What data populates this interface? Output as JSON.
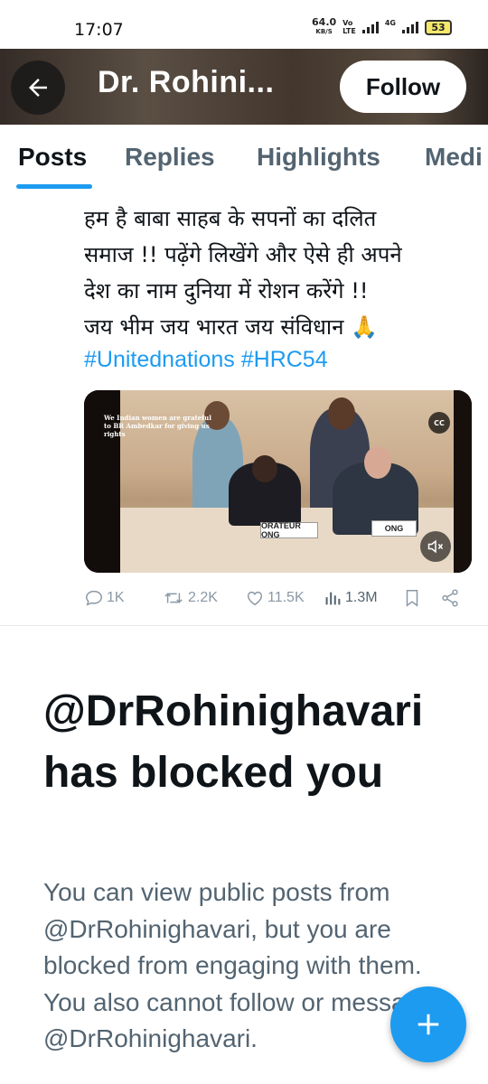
{
  "status_bar": {
    "time": "17:07",
    "net_speed_value": "64.0",
    "net_speed_unit": "KB/S",
    "volte_top": "Vo",
    "volte_bottom": "LTE",
    "network": "4G",
    "battery": "53"
  },
  "header": {
    "title": "Dr. Rohini...",
    "follow_label": "Follow",
    "back_icon": "arrow-left-icon"
  },
  "tabs": [
    {
      "label": "Posts",
      "active": true
    },
    {
      "label": "Replies",
      "active": false
    },
    {
      "label": "Highlights",
      "active": false
    },
    {
      "label": "Medi",
      "active": false
    }
  ],
  "post": {
    "text_lines": [
      "हम है बाबा साहब के सपनों का दलित",
      "समाज !! पढ़ेंगे लिखेंगे और ऐसे ही अपने",
      "देश का नाम दुनिया में रोशन करेंगे !!",
      "जय भीम जय भारत जय संविधान 🙏"
    ],
    "hashtags": "#Unitednations #HRC54",
    "media": {
      "caption": "We Indian women are grateful to BR Ambedkar for giving us rights",
      "sign_left": "ORATEUR ONG",
      "sign_right": "ONG",
      "cc_label": "CC"
    },
    "stats": {
      "replies": "1K",
      "reposts": "2.2K",
      "likes": "11.5K",
      "views": "1.3M"
    }
  },
  "blocked": {
    "title": "@DrRohinighavari has blocked you",
    "description": "You can view public posts from @DrRohinighavari, but you are blocked from engaging with them. You also cannot follow or message @DrRohinighavari."
  },
  "colors": {
    "accent": "#1d9bf0",
    "text_primary": "#0f1419",
    "text_secondary": "#536471"
  }
}
